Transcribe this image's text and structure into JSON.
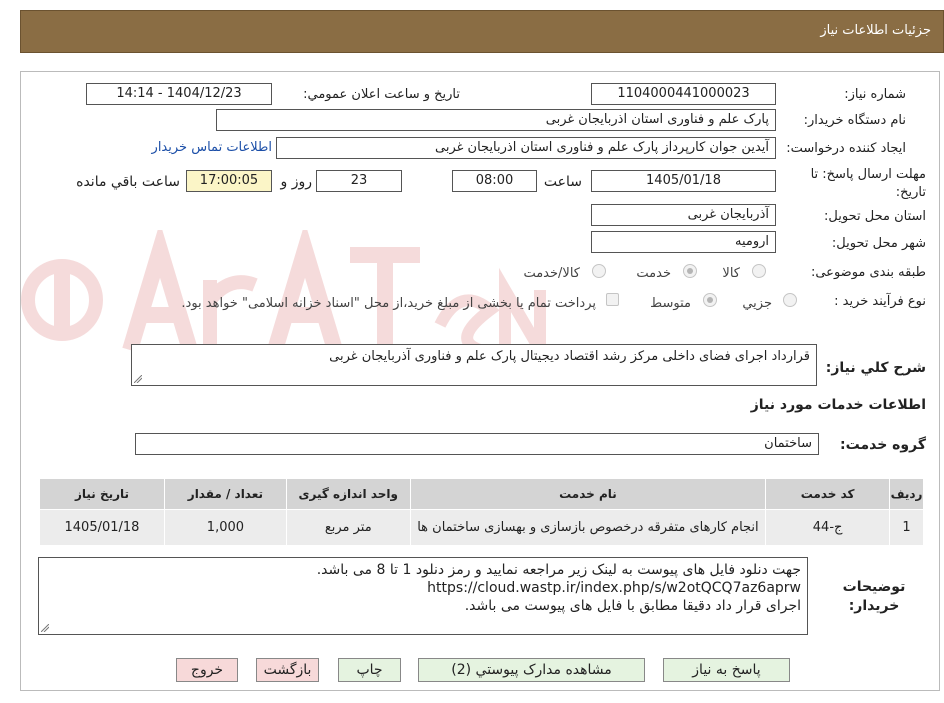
{
  "header": {
    "title": "جزئيات اطلاعات نياز"
  },
  "form": {
    "need_number_label": "شماره نياز:",
    "need_number": "1104000441000023",
    "announce_label": "تاريخ و ساعت اعلان عمومي:",
    "announce_value": "1404/12/23 - 14:14",
    "buyer_org_label": "نام دستگاه خريدار:",
    "buyer_org": "پارک علم و فناوری استان اذربایجان غربی",
    "requester_label": "ايجاد کننده درخواست:",
    "requester": "آیدین جوان کارپرداز پارک علم و فناوری استان اذربایجان غربی",
    "contact_link": "اطلاعات تماس خريدار",
    "deadline_label": "مهلت ارسال پاسخ: تا تاریخ:",
    "deadline_date": "1405/01/18",
    "time_label": "ساعت",
    "deadline_time": "08:00",
    "days_value": "23",
    "days_label": "روز و",
    "remaining_time": "17:00:05",
    "remaining_label": "ساعت باقي مانده",
    "province_label": "استان محل تحويل:",
    "province": "آذربايجان غربی",
    "city_label": "شهر محل تحويل:",
    "city": "ارومیه",
    "category_label": "طبقه بندی موضوعی:",
    "category_options": [
      "کالا",
      "خدمت",
      "کالا/خدمت"
    ],
    "category_selected": "خدمت",
    "process_label": "نوع فرآيند خريد :",
    "process_options": [
      "جزيي",
      "متوسط"
    ],
    "process_selected": "متوسط",
    "payment_note": "پرداخت تمام یا بخشی از مبلغ خرید،از محل \"اسناد خزانه اسلامی\" خواهد بود."
  },
  "description": {
    "label": "شرح کلي نياز:",
    "value": "قرارداد اجرای فضای داخلی مرکز رشد اقتصاد دیجیتال پارک علم و فناوری آذربایجان غربی"
  },
  "services": {
    "section_title": "اطلاعات خدمات مورد نياز",
    "group_label": "گروه خدمت:",
    "group_value": "ساختمان",
    "columns": [
      "رديف",
      "کد خدمت",
      "نام خدمت",
      "واحد اندازه گيری",
      "تعداد / مقدار",
      "تاريخ نياز"
    ],
    "rows": [
      [
        "1",
        "ج-44",
        "انجام کارهای متفرقه درخصوص بازسازی و بهسازی ساختمان ها",
        "متر مربع",
        "1,000",
        "1405/01/18"
      ]
    ]
  },
  "buyer_notes": {
    "label": "توضيحات خريدار:",
    "lines": [
      "جهت دنلود فایل های پیوست به لینک زیر مراجعه نمایید و رمز دنلود 1 تا 8 می باشد.",
      "https://cloud.wastp.ir/index.php/s/w2otQCQ7az6aprw",
      "اجرای قرار داد دقیقا مطابق با فایل های پیوست می باشد."
    ]
  },
  "buttons": {
    "reply": "پاسخ به نياز",
    "attachments": "مشاهده مدارک پيوستي (2)",
    "print": "چاپ",
    "back": "بازگشت",
    "exit": "خروج"
  },
  "colors": {
    "header_bg": "#8a6d44",
    "watermark": "#c62828",
    "link": "#1c4fa8"
  }
}
